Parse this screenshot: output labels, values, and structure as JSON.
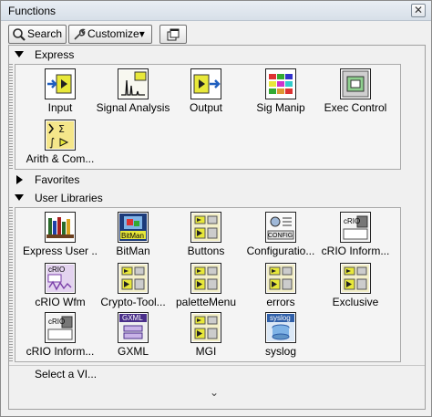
{
  "window": {
    "title": "Functions",
    "close_glyph": "✕"
  },
  "toolbar": {
    "search_label": "Search",
    "customize_label": "Customize",
    "customize_arrow": "▾"
  },
  "sections": [
    {
      "name": "Express",
      "expanded": true,
      "items": [
        {
          "label": "Input",
          "icon": "input-icon"
        },
        {
          "label": "Signal Analysis",
          "icon": "signal-analysis-icon"
        },
        {
          "label": "Output",
          "icon": "output-icon"
        },
        {
          "label": "Sig Manip",
          "icon": "sig-manip-icon"
        },
        {
          "label": "Exec Control",
          "icon": "exec-control-icon"
        },
        {
          "label": "Arith & Com...",
          "icon": "arith-comparison-icon"
        }
      ]
    },
    {
      "name": "Favorites",
      "expanded": false,
      "items": []
    },
    {
      "name": "User Libraries",
      "expanded": true,
      "items": [
        {
          "label": "Express User ...",
          "icon": "express-user-libs-icon"
        },
        {
          "label": "BitMan",
          "icon": "bitman-icon",
          "icon_text": "BitMan"
        },
        {
          "label": "Buttons",
          "icon": "buttons-icon"
        },
        {
          "label": "Configuratio...",
          "icon": "config-icon",
          "icon_text": "CONFIG"
        },
        {
          "label": "cRIO Inform...",
          "icon": "crio-info-icon",
          "icon_text": "cRIO"
        },
        {
          "label": "cRIO Wfm",
          "icon": "crio-wfm-icon",
          "icon_text": "cRIO"
        },
        {
          "label": "Crypto-Tool...",
          "icon": "crypto-tool-icon"
        },
        {
          "label": "paletteMenu",
          "icon": "palette-menu-icon"
        },
        {
          "label": "errors",
          "icon": "errors-icon"
        },
        {
          "label": "Exclusive",
          "icon": "exclusive-icon"
        },
        {
          "label": "cRIO Inform...",
          "icon": "crio-info-icon",
          "icon_text": "cRIO"
        },
        {
          "label": "GXML",
          "icon": "gxml-icon",
          "icon_text": "GXML"
        },
        {
          "label": "MGI",
          "icon": "mgi-icon"
        },
        {
          "label": "syslog",
          "icon": "syslog-icon",
          "icon_text": "syslog"
        }
      ]
    }
  ],
  "footer": {
    "select_vi": "Select a VI...",
    "more_glyph": "⌄"
  },
  "colors": {
    "panel_bg": "#f0f0f0",
    "border": "#a9a9a9",
    "accent": "#1f5fbf"
  }
}
